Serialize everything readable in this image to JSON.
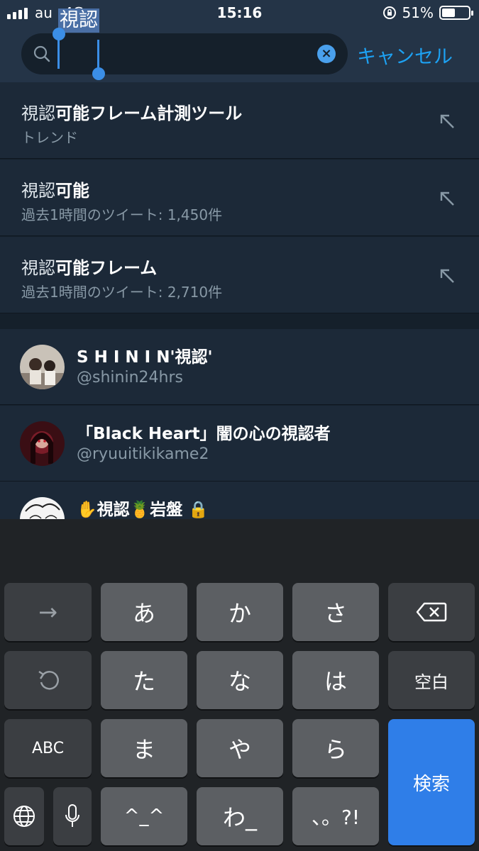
{
  "status_bar": {
    "carrier": "au",
    "network": "4G",
    "time": "15:16",
    "battery_percent": "51%",
    "battery_level": 0.51
  },
  "search": {
    "query": "視認",
    "cancel_label": "キャンセル"
  },
  "suggestions": [
    {
      "prefix": "視認",
      "rest": "可能フレーム計測ツール",
      "sub": "トレンド"
    },
    {
      "prefix": "視認",
      "rest": "可能",
      "sub": "過去1時間のツイート: 1,450件"
    },
    {
      "prefix": "視認",
      "rest": "可能フレーム",
      "sub": "過去1時間のツイート: 2,710件"
    }
  ],
  "users": [
    {
      "name": "S H I N I N'視認'",
      "handle": "@shinin24hrs"
    },
    {
      "name": "「Black Heart」闇の心の視認者",
      "handle": "@ryuuitikikame2"
    },
    {
      "name": "✋視認🍍岩盤 🔒",
      "handle": ""
    }
  ],
  "keyboard": {
    "row1": [
      "→",
      "あ",
      "か",
      "さ",
      "⌫"
    ],
    "row2": [
      "↺",
      "た",
      "な",
      "は",
      "空白"
    ],
    "row3": [
      "ABC",
      "ま",
      "や",
      "ら"
    ],
    "row4": [
      "🌐",
      "🎤",
      "^_^",
      "わ_",
      "、。?!"
    ],
    "enter_label": "検索"
  }
}
